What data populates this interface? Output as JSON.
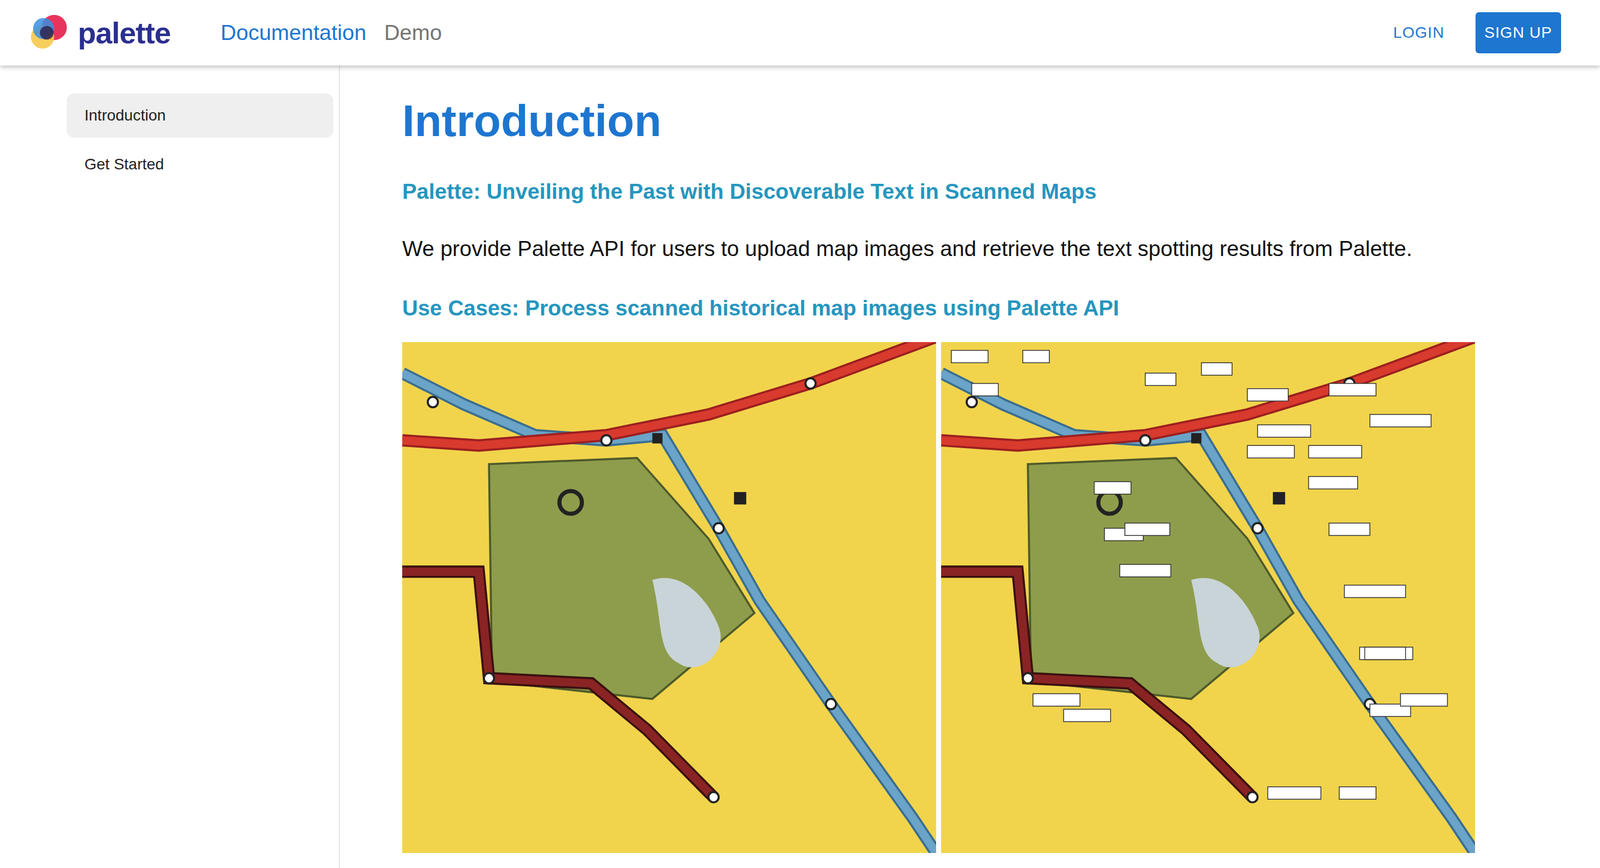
{
  "header": {
    "logo": "palette",
    "nav": [
      {
        "label": "Documentation",
        "selected": true
      },
      {
        "label": "Demo",
        "selected": false
      }
    ],
    "login": "LOGIN",
    "signup": "SIGN UP"
  },
  "sidebar": {
    "items": [
      {
        "label": "Introduction",
        "selected": true
      },
      {
        "label": "Get Started",
        "selected": false
      }
    ]
  },
  "content": {
    "title": "Introduction",
    "subtitle": "Palette: Unveiling the Past with Discoverable Text in Scanned Maps",
    "paragraph": "We provide Palette API for users to upload map images and retrieve the text spotting results from Palette.",
    "use_cases_heading": "Use Cases: Process scanned historical map images using Palette API"
  }
}
